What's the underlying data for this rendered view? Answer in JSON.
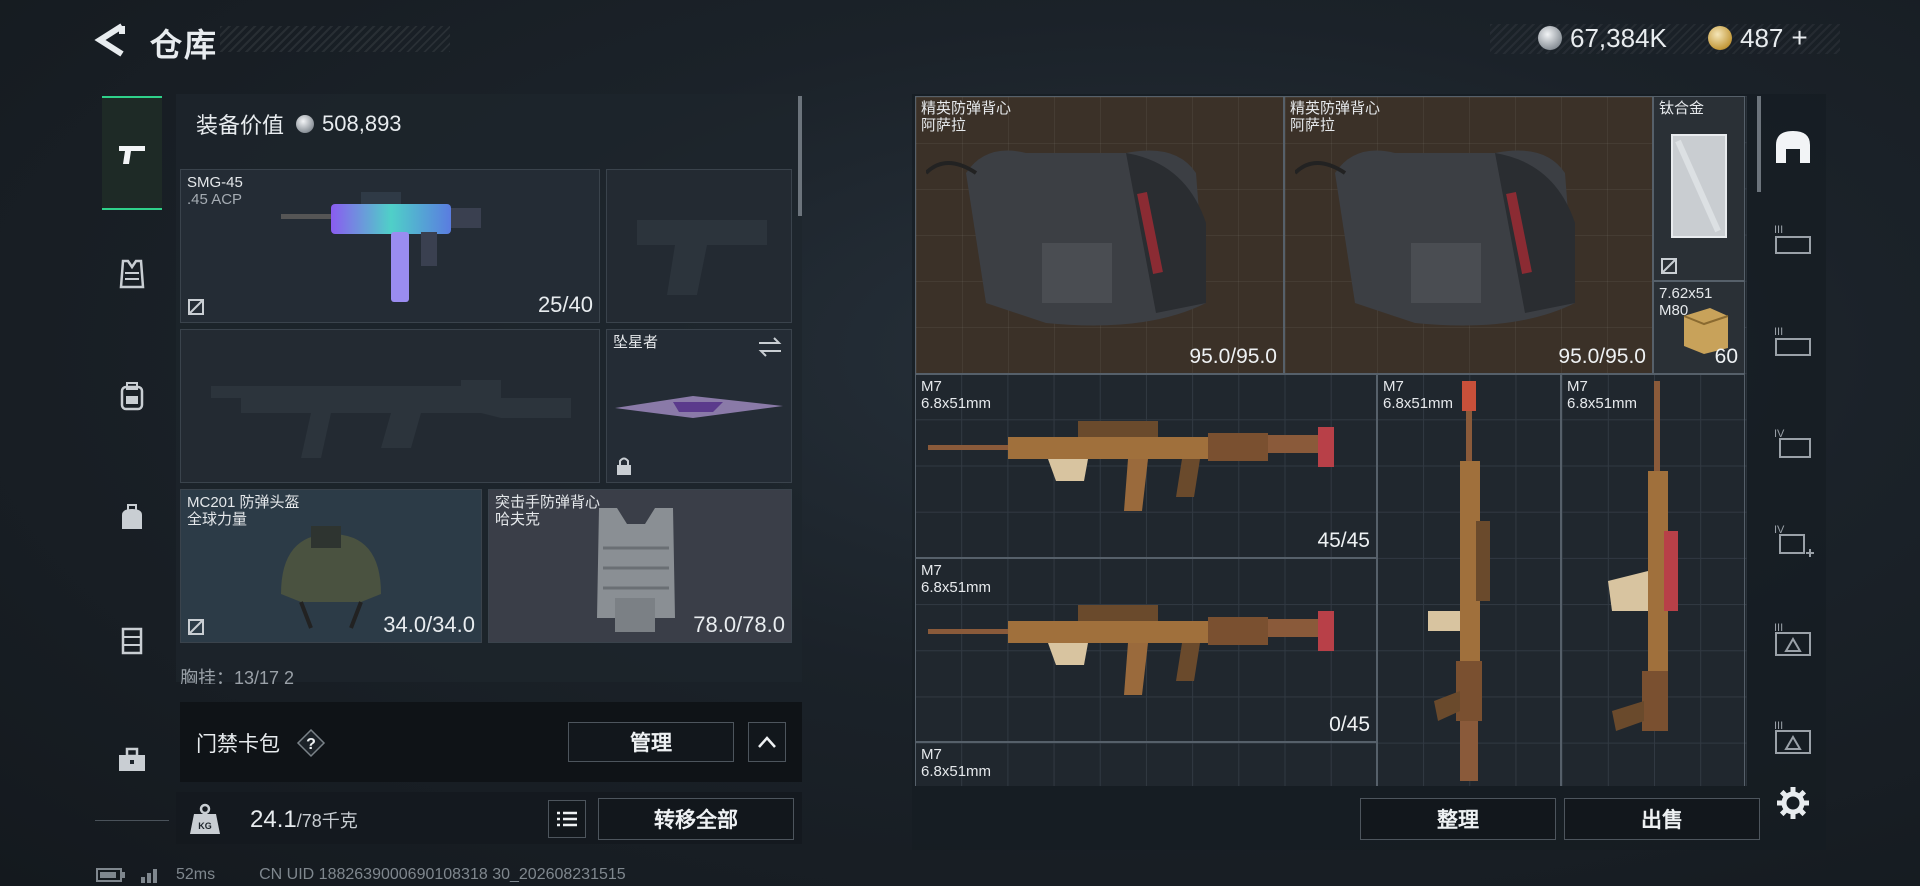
{
  "header": {
    "title": "仓库",
    "currency_silver": "67,384K",
    "currency_gold": "487"
  },
  "left_tabs": [
    {
      "name": "weapons",
      "icon": "pistol-icon",
      "active": true
    },
    {
      "name": "armor",
      "icon": "vest-icon"
    },
    {
      "name": "backpack",
      "icon": "backpack-icon"
    },
    {
      "name": "items",
      "icon": "bag-icon"
    },
    {
      "name": "chest-rig",
      "icon": "rig-icon"
    },
    {
      "name": "toolbox",
      "icon": "toolbox-icon"
    }
  ],
  "loadout": {
    "value_label": "装备价值",
    "value": "508,893",
    "primary": {
      "name": "SMG-45",
      "ammo": ".45 ACP",
      "count": "25/40"
    },
    "melee": {
      "name": "坠星者"
    },
    "helmet": {
      "name": "MC201 防弹头盔",
      "brand": "全球力量",
      "durability": "34.0/34.0"
    },
    "vest": {
      "name": "突击手防弹背心",
      "brand": "哈夫克",
      "durability": "78.0/78.0"
    },
    "chest_row": "胸挂：13/17   2"
  },
  "keycard": {
    "label": "门禁卡包",
    "help": "?",
    "manage_label": "管理"
  },
  "weight": {
    "value": "24.1",
    "unit": "/78千克",
    "transfer_all_label": "转移全部"
  },
  "storage": {
    "items": [
      {
        "name": "精英防弹背心",
        "brand": "阿萨拉",
        "durability": "95.0/95.0"
      },
      {
        "name": "精英防弹背心",
        "brand": "阿萨拉",
        "durability": "95.0/95.0"
      },
      {
        "name": "钛合金"
      },
      {
        "name": "7.62x51",
        "sub": "M80",
        "count": "60"
      },
      {
        "name": "M7",
        "ammo": "6.8x51mm",
        "count": "45/45"
      },
      {
        "name": "M7",
        "ammo": "6.8x51mm",
        "count": "0/45"
      },
      {
        "name": "M7",
        "ammo": "6.8x51mm"
      },
      {
        "name": "M7",
        "ammo": "6.8x51mm"
      },
      {
        "name": "M7",
        "ammo": "6.8x51mm"
      }
    ],
    "sort_label": "整理",
    "sell_label": "出售"
  },
  "side_icons": [
    "safe-icon",
    "shelf-3-icon",
    "shelf-3b-icon",
    "shelf-4-icon",
    "shelf-4-plus-icon",
    "shelf-5-icon",
    "shelf-6-icon",
    "settings-icon"
  ],
  "footer": {
    "ping": "52ms",
    "uid": "CN UID 1882639000690108318 30_202608231515"
  },
  "colors": {
    "accent": "#2fd18a",
    "vest_bg": "#3b3128",
    "helmet_bg": "#2c3b47"
  }
}
